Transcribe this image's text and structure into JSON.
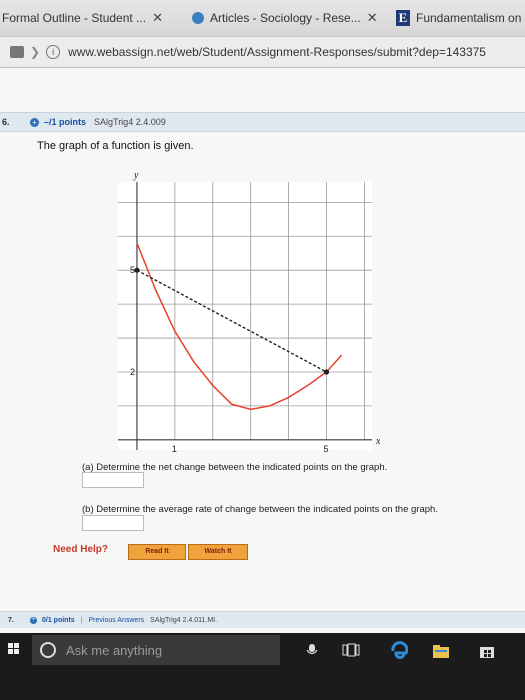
{
  "browser": {
    "tabs": [
      {
        "label": "Formal Outline - Student ...",
        "close": "✕"
      },
      {
        "label": "Articles - Sociology - Rese...",
        "close": "✕"
      },
      {
        "label": "Fundamentalism on",
        "favicon_letter": "E"
      }
    ],
    "url": "www.webassign.net/web/Student/Assignment-Responses/submit?dep=143375",
    "info_glyph": "i"
  },
  "question": {
    "number": "6.",
    "points": "–/1 points",
    "id": "SAlgTrig4 2.4.009",
    "prompt": "The graph of a function is given.",
    "part_a": "(a) Determine the net change between the indicated points on the graph.",
    "part_b": "(b) Determine the average rate of change between the indicated points on the graph.",
    "need_help": "Need Help?",
    "read_it": "Read It",
    "watch_it": "Watch It"
  },
  "next_question": {
    "number": "7.",
    "points": "0/1 points",
    "separator": "|",
    "previous_answers": "Previous Answers",
    "id": "SAlgTrig4 2.4.011.MI."
  },
  "taskbar": {
    "search_placeholder": "Ask me anything"
  },
  "chart_data": {
    "type": "line",
    "xlabel": "x",
    "ylabel": "y",
    "x_tick_labels": [
      {
        "x": 1,
        "label": "1"
      },
      {
        "x": 5,
        "label": "5"
      }
    ],
    "y_tick_labels": [
      {
        "y": 2,
        "label": "2"
      },
      {
        "y": 5,
        "label": "5"
      }
    ],
    "xlim": [
      -0.5,
      6.2
    ],
    "ylim": [
      -0.3,
      7.6
    ],
    "grid": true,
    "series": [
      {
        "role": "curve",
        "color": "#e8402a",
        "x": [
          0,
          0.5,
          1,
          1.5,
          2,
          2.5,
          3,
          3.5,
          4,
          4.5,
          5,
          5.4
        ],
        "y": [
          5.8,
          4.4,
          3.2,
          2.3,
          1.6,
          1.05,
          0.9,
          1.0,
          1.25,
          1.6,
          2.0,
          2.5
        ]
      },
      {
        "role": "secant",
        "style": "dashed",
        "color": "#222222",
        "x": [
          0,
          5
        ],
        "y": [
          5,
          2
        ]
      }
    ],
    "points": [
      {
        "x": 0,
        "y": 5
      },
      {
        "x": 5,
        "y": 2
      }
    ]
  },
  "colors": {
    "curve": "#e8402a",
    "help_button": "#f0a33c",
    "need_help_text": "#c0392b"
  }
}
